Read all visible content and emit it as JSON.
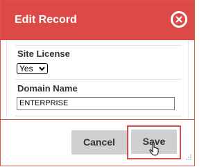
{
  "dialog": {
    "title": "Edit Record",
    "fields": [
      {
        "label": "Site License",
        "value": "Yes"
      },
      {
        "label": "Domain Name",
        "value": "ENTERPRISE"
      }
    ],
    "cancel_label": "Cancel",
    "save_label": "Save"
  },
  "colors": {
    "header": "#dc4a48",
    "button": "#d0d0d0",
    "highlight": "#dc4a48"
  },
  "icons": {
    "close": "close-circle-icon",
    "cursor": "hand-pointer-icon",
    "resize": "resize-grip-icon"
  }
}
